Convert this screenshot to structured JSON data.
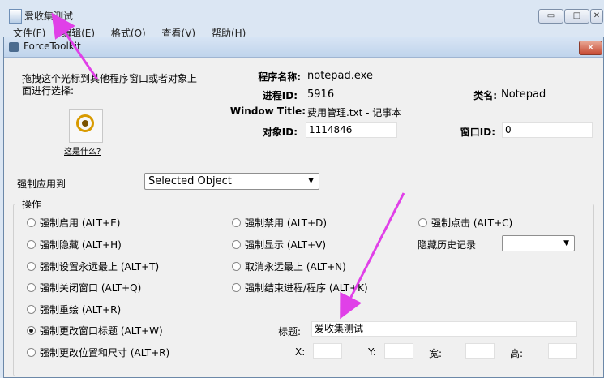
{
  "background_window": {
    "title": "爱收集测试",
    "menu": [
      "文件(F)",
      "编辑(E)",
      "格式(O)",
      "查看(V)",
      "帮助(H)"
    ],
    "buttons": {
      "minimize": "▭",
      "maximize": "□",
      "close": "✕"
    }
  },
  "dialog": {
    "title": "ForceToolkit",
    "close_label": "✕",
    "instruction_line1": "拖拽这个光标到其他程序窗口或者对象上",
    "instruction_line2": "面进行选择:",
    "finder_caption": "这是什么?",
    "info": {
      "program_name_label": "程序名称:",
      "program_name_value": "notepad.exe",
      "process_id_label": "进程ID:",
      "process_id_value": "5916",
      "class_label": "类名:",
      "class_value": "Notepad",
      "window_title_label": "Window Title:",
      "window_title_value": "费用管理.txt - 记事本",
      "object_id_label": "对象ID:",
      "object_id_value": "1114846",
      "window_id_label": "窗口ID:",
      "window_id_value": "0"
    },
    "apply_to_label": "强制应用到",
    "apply_to_value": "Selected Object",
    "operations_title": "操作",
    "ops": {
      "enable": "强制启用 (ALT+E)",
      "disable": "强制禁用 (ALT+D)",
      "click": "强制点击 (ALT+C)",
      "hide": "强制隐藏 (ALT+H)",
      "show": "强制显示 (ALT+V)",
      "hide_history_label": "隐藏历史记录",
      "topmost": "强制设置永远最上 (ALT+T)",
      "untopmost": "取消永远最上 (ALT+N)",
      "close": "强制关闭窗口 (ALT+Q)",
      "kill": "强制结束进程/程序 (ALT+K)",
      "redraw": "强制重绘 (ALT+R)",
      "change_title": "强制更改窗口标题 (ALT+W)",
      "change_pos": "强制更改位置和尺寸 (ALT+R)"
    },
    "title_field_label": "标题:",
    "title_field_value": "爱收集测试",
    "x_label": "X:",
    "y_label": "Y:",
    "width_label": "宽:",
    "height_label": "高:",
    "selected_operation": "change_title"
  },
  "colors": {
    "annotation_arrow": "#e040e8"
  }
}
